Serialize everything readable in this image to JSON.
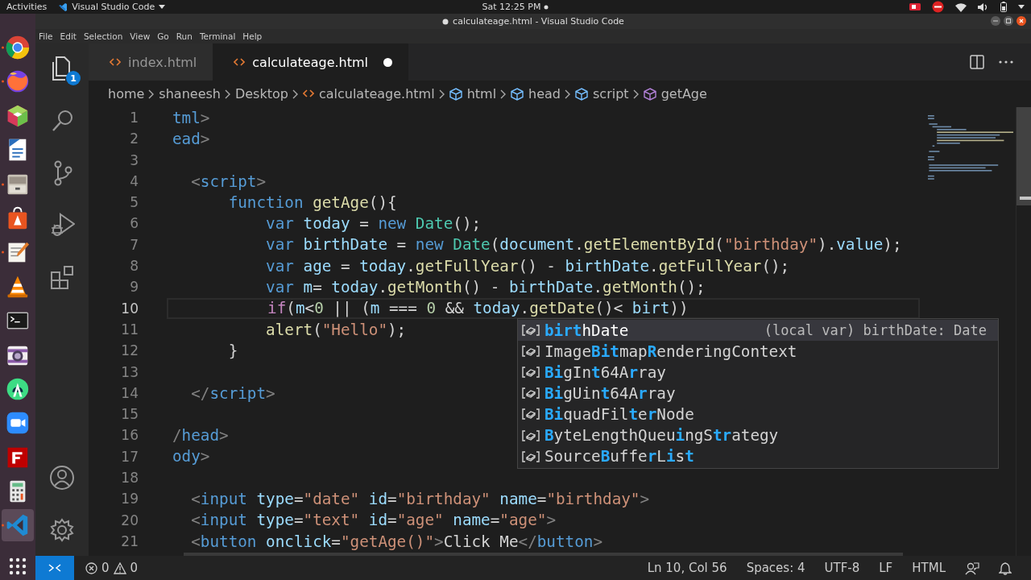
{
  "top_bar": {
    "activities": "Activities",
    "app_menu": "Visual Studio Code",
    "clock": "Sat 12:25 PM",
    "notification": true
  },
  "window": {
    "title": "calculateage.html - Visual Studio Code",
    "modified": true
  },
  "menu": [
    "File",
    "Edit",
    "Selection",
    "View",
    "Go",
    "Run",
    "Terminal",
    "Help"
  ],
  "dock": [
    {
      "kind": "globe",
      "running": true,
      "selected": false
    },
    {
      "kind": "fox",
      "running": true,
      "selected": false
    },
    {
      "kind": "cube",
      "running": false,
      "selected": false
    },
    {
      "kind": "document",
      "running": false,
      "selected": false
    },
    {
      "kind": "cabinet",
      "running": true,
      "selected": false
    },
    {
      "kind": "bag",
      "running": false,
      "selected": false
    },
    {
      "kind": "notepad",
      "running": true,
      "selected": false
    },
    {
      "kind": "cone",
      "running": false,
      "selected": false
    },
    {
      "kind": "terminal",
      "running": false,
      "selected": false
    },
    {
      "kind": "camera",
      "running": false,
      "selected": false
    },
    {
      "kind": "android",
      "running": false,
      "selected": false
    },
    {
      "kind": "video",
      "running": false,
      "selected": false
    },
    {
      "kind": "ftp",
      "running": false,
      "selected": false
    },
    {
      "kind": "calculator",
      "running": false,
      "selected": false
    },
    {
      "kind": "editor",
      "running": true,
      "selected": true
    }
  ],
  "activity_bar": [
    {
      "kind": "explorer",
      "badge": "1"
    },
    {
      "kind": "search"
    },
    {
      "kind": "source-control"
    },
    {
      "kind": "run"
    },
    {
      "kind": "extensions"
    },
    {
      "kind": "account"
    },
    {
      "kind": "settings"
    }
  ],
  "tabs": [
    {
      "label": "index.html",
      "selected": false,
      "modified": false
    },
    {
      "label": "calculateage.html",
      "selected": true,
      "modified": true
    }
  ],
  "breadcrumbs": [
    {
      "kind": "folder",
      "label": "home"
    },
    {
      "kind": "folder",
      "label": "shaneesh"
    },
    {
      "kind": "folder",
      "label": "Desktop"
    },
    {
      "kind": "file",
      "label": "calculateage.html"
    },
    {
      "kind": "element",
      "label": "html"
    },
    {
      "kind": "element",
      "label": "head"
    },
    {
      "kind": "element",
      "label": "script"
    },
    {
      "kind": "function",
      "label": "getAge"
    }
  ],
  "editor": {
    "lines": [
      {
        "number": "1",
        "current": false,
        "tokens": [
          {
            "kind": "tag",
            "text": "tml"
          },
          {
            "kind": "punct",
            "text": ">"
          }
        ]
      },
      {
        "number": "2",
        "current": false,
        "tokens": [
          {
            "kind": "tag",
            "text": "ead"
          },
          {
            "kind": "punct",
            "text": ">"
          }
        ]
      },
      {
        "number": "3",
        "current": false
      },
      {
        "number": "4",
        "current": false,
        "tokens": [
          {
            "kind": "punct",
            "text": "  <"
          },
          {
            "kind": "tag",
            "text": "script"
          },
          {
            "kind": "punct",
            "text": ">"
          }
        ]
      },
      {
        "number": "5",
        "current": false,
        "tokens": [
          {
            "kind": "keyword",
            "text": "      function "
          },
          {
            "kind": "function",
            "text": "getAge"
          },
          {
            "kind": "plain",
            "text": "(){"
          }
        ]
      },
      {
        "number": "6",
        "current": false,
        "tokens": [
          {
            "kind": "keyword",
            "text": "          var "
          },
          {
            "kind": "variable",
            "text": "today"
          },
          {
            "kind": "plain",
            "text": " = "
          },
          {
            "kind": "keyword",
            "text": "new "
          },
          {
            "kind": "class",
            "text": "Date"
          },
          {
            "kind": "plain",
            "text": "();"
          }
        ]
      },
      {
        "number": "7",
        "current": false,
        "tokens": [
          {
            "kind": "keyword",
            "text": "          var "
          },
          {
            "kind": "variable",
            "text": "birthDate"
          },
          {
            "kind": "plain",
            "text": " = "
          },
          {
            "kind": "keyword",
            "text": "new "
          },
          {
            "kind": "class",
            "text": "Date"
          },
          {
            "kind": "plain",
            "text": "("
          },
          {
            "kind": "variable",
            "text": "document"
          },
          {
            "kind": "plain",
            "text": "."
          },
          {
            "kind": "function",
            "text": "getElementById"
          },
          {
            "kind": "plain",
            "text": "("
          },
          {
            "kind": "string",
            "text": "\"birthday\""
          },
          {
            "kind": "plain",
            "text": ")."
          },
          {
            "kind": "variable",
            "text": "value"
          },
          {
            "kind": "plain",
            "text": ");"
          }
        ]
      },
      {
        "number": "8",
        "current": false,
        "tokens": [
          {
            "kind": "keyword",
            "text": "          var "
          },
          {
            "kind": "variable",
            "text": "age"
          },
          {
            "kind": "plain",
            "text": " = "
          },
          {
            "kind": "variable",
            "text": "today"
          },
          {
            "kind": "plain",
            "text": "."
          },
          {
            "kind": "function",
            "text": "getFullYear"
          },
          {
            "kind": "plain",
            "text": "() - "
          },
          {
            "kind": "variable",
            "text": "birthDate"
          },
          {
            "kind": "plain",
            "text": "."
          },
          {
            "kind": "function",
            "text": "getFullYear"
          },
          {
            "kind": "plain",
            "text": "();"
          }
        ]
      },
      {
        "number": "9",
        "current": false,
        "tokens": [
          {
            "kind": "keyword",
            "text": "          var "
          },
          {
            "kind": "variable",
            "text": "m"
          },
          {
            "kind": "plain",
            "text": "= "
          },
          {
            "kind": "variable",
            "text": "today"
          },
          {
            "kind": "plain",
            "text": "."
          },
          {
            "kind": "function",
            "text": "getMonth"
          },
          {
            "kind": "plain",
            "text": "() - "
          },
          {
            "kind": "variable",
            "text": "birthDate"
          },
          {
            "kind": "plain",
            "text": "."
          },
          {
            "kind": "function",
            "text": "getMonth"
          },
          {
            "kind": "plain",
            "text": "();"
          }
        ]
      },
      {
        "number": "10",
        "current": true,
        "tokens": [
          {
            "kind": "control",
            "text": "          if"
          },
          {
            "kind": "plain",
            "text": "("
          },
          {
            "kind": "variable",
            "text": "m"
          },
          {
            "kind": "plain",
            "text": "<"
          },
          {
            "kind": "number",
            "text": "0"
          },
          {
            "kind": "plain",
            "text": " || ("
          },
          {
            "kind": "variable",
            "text": "m"
          },
          {
            "kind": "plain",
            "text": " === "
          },
          {
            "kind": "number",
            "text": "0"
          },
          {
            "kind": "plain",
            "text": " && "
          },
          {
            "kind": "variable",
            "text": "today"
          },
          {
            "kind": "plain",
            "text": "."
          },
          {
            "kind": "function",
            "text": "getDate"
          },
          {
            "kind": "plain",
            "text": "()< "
          },
          {
            "kind": "variable",
            "text": "birt"
          },
          {
            "kind": "plain",
            "text": "))"
          }
        ]
      },
      {
        "number": "11",
        "current": false,
        "tokens": [
          {
            "kind": "function",
            "text": "          alert"
          },
          {
            "kind": "plain",
            "text": "("
          },
          {
            "kind": "string",
            "text": "\"Hello\""
          },
          {
            "kind": "plain",
            "text": ");"
          }
        ]
      },
      {
        "number": "12",
        "current": false,
        "tokens": [
          {
            "kind": "plain",
            "text": "      }"
          }
        ]
      },
      {
        "number": "13",
        "current": false
      },
      {
        "number": "14",
        "current": false,
        "tokens": [
          {
            "kind": "punct",
            "text": "  </"
          },
          {
            "kind": "tag",
            "text": "script"
          },
          {
            "kind": "punct",
            "text": ">"
          }
        ]
      },
      {
        "number": "15",
        "current": false
      },
      {
        "number": "16",
        "current": false,
        "tokens": [
          {
            "kind": "punct",
            "text": "/"
          },
          {
            "kind": "tag",
            "text": "head"
          },
          {
            "kind": "punct",
            "text": ">"
          }
        ]
      },
      {
        "number": "17",
        "current": false,
        "tokens": [
          {
            "kind": "tag",
            "text": "ody"
          },
          {
            "kind": "punct",
            "text": ">"
          }
        ]
      },
      {
        "number": "18",
        "current": false
      },
      {
        "number": "19",
        "current": false,
        "tokens": [
          {
            "kind": "punct",
            "text": "  <"
          },
          {
            "kind": "tag",
            "text": "input "
          },
          {
            "kind": "attr",
            "text": "type"
          },
          {
            "kind": "plain",
            "text": "="
          },
          {
            "kind": "string",
            "text": "\"date\" "
          },
          {
            "kind": "attr",
            "text": "id"
          },
          {
            "kind": "plain",
            "text": "="
          },
          {
            "kind": "string",
            "text": "\"birthday\" "
          },
          {
            "kind": "attr",
            "text": "name"
          },
          {
            "kind": "plain",
            "text": "="
          },
          {
            "kind": "string",
            "text": "\"birthday\""
          },
          {
            "kind": "punct",
            "text": ">"
          }
        ]
      },
      {
        "number": "20",
        "current": false,
        "tokens": [
          {
            "kind": "punct",
            "text": "  <"
          },
          {
            "kind": "tag",
            "text": "input "
          },
          {
            "kind": "attr",
            "text": "type"
          },
          {
            "kind": "plain",
            "text": "="
          },
          {
            "kind": "string",
            "text": "\"text\" "
          },
          {
            "kind": "attr",
            "text": "id"
          },
          {
            "kind": "plain",
            "text": "="
          },
          {
            "kind": "string",
            "text": "\"age\" "
          },
          {
            "kind": "attr",
            "text": "name"
          },
          {
            "kind": "plain",
            "text": "="
          },
          {
            "kind": "string",
            "text": "\"age\""
          },
          {
            "kind": "punct",
            "text": ">"
          }
        ]
      },
      {
        "number": "21",
        "current": false,
        "tokens": [
          {
            "kind": "punct",
            "text": "  <"
          },
          {
            "kind": "tag",
            "text": "button "
          },
          {
            "kind": "attr",
            "text": "onclick"
          },
          {
            "kind": "plain",
            "text": "="
          },
          {
            "kind": "string",
            "text": "\"getAge()\""
          },
          {
            "kind": "punct",
            "text": ">"
          },
          {
            "kind": "plain",
            "text": "Click Me"
          },
          {
            "kind": "punct",
            "text": "</"
          },
          {
            "kind": "tag",
            "text": "button"
          },
          {
            "kind": "punct",
            "text": ">"
          }
        ]
      }
    ]
  },
  "suggestions": [
    {
      "selected": true,
      "parts": [
        {
          "text": "birt",
          "match": true
        },
        {
          "text": "hDate",
          "match": false
        }
      ],
      "detail": "(local var) birthDate: Date"
    },
    {
      "selected": false,
      "parts": [
        {
          "text": "Image",
          "match": false
        },
        {
          "text": "Bit",
          "match": true
        },
        {
          "text": "map",
          "match": false
        },
        {
          "text": "R",
          "match": true
        },
        {
          "text": "enderingContext",
          "match": false
        }
      ]
    },
    {
      "selected": false,
      "parts": [
        {
          "text": "Bi",
          "match": true
        },
        {
          "text": "gIn",
          "match": false
        },
        {
          "text": "t",
          "match": true
        },
        {
          "text": "64A",
          "match": false
        },
        {
          "text": "r",
          "match": true
        },
        {
          "text": "ray",
          "match": false
        }
      ]
    },
    {
      "selected": false,
      "parts": [
        {
          "text": "Bi",
          "match": true
        },
        {
          "text": "gUin",
          "match": false
        },
        {
          "text": "t",
          "match": true
        },
        {
          "text": "64A",
          "match": false
        },
        {
          "text": "r",
          "match": true
        },
        {
          "text": "ray",
          "match": false
        }
      ]
    },
    {
      "selected": false,
      "parts": [
        {
          "text": "Bi",
          "match": true
        },
        {
          "text": "quadFil",
          "match": false
        },
        {
          "text": "t",
          "match": true
        },
        {
          "text": "e",
          "match": false
        },
        {
          "text": "r",
          "match": true
        },
        {
          "text": "Node",
          "match": false
        }
      ]
    },
    {
      "selected": false,
      "parts": [
        {
          "text": "B",
          "match": true
        },
        {
          "text": "yteLengthQueu",
          "match": false
        },
        {
          "text": "i",
          "match": true
        },
        {
          "text": "ngS",
          "match": false
        },
        {
          "text": "tr",
          "match": true
        },
        {
          "text": "ategy",
          "match": false
        }
      ]
    },
    {
      "selected": false,
      "parts": [
        {
          "text": "Source",
          "match": false
        },
        {
          "text": "B",
          "match": true
        },
        {
          "text": "uffe",
          "match": false
        },
        {
          "text": "r",
          "match": true
        },
        {
          "text": "L",
          "match": false
        },
        {
          "text": "i",
          "match": true
        },
        {
          "text": "s",
          "match": false
        },
        {
          "text": "t",
          "match": true
        }
      ]
    }
  ],
  "status_bar": {
    "errors": "0",
    "warnings": "0",
    "position": "Ln 10, Col 56",
    "indent": "Spaces: 4",
    "encoding": "UTF-8",
    "eol": "LF",
    "language": "HTML"
  }
}
